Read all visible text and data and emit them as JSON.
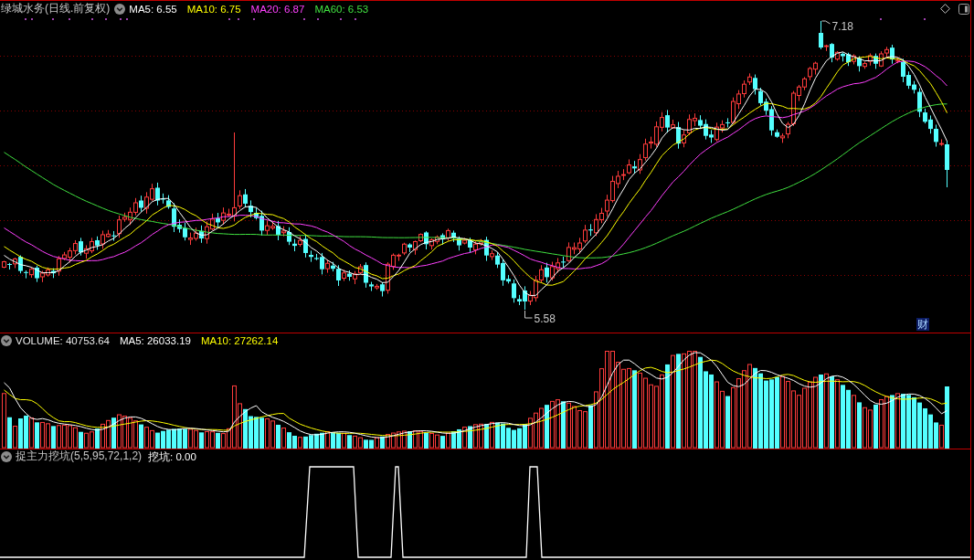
{
  "price_panel": {
    "title": "绿城水务(日线.前复权)",
    "indicators": [
      {
        "label": "MA5: 6.55",
        "color": "#ffffff"
      },
      {
        "label": "MA10: 6.75",
        "color": "#ffff00"
      },
      {
        "label": "MA20: 6.87",
        "color": "#ff40ff"
      },
      {
        "label": "MA60: 6.53",
        "color": "#40e040"
      }
    ],
    "high_label": "7.18",
    "low_label": "5.58",
    "badge": "财"
  },
  "volume_panel": {
    "indicators": [
      {
        "label": "VOLUME: 40753.64",
        "color": "#e8e8e8"
      },
      {
        "label": "MA5: 26033.19",
        "color": "#ffffff"
      },
      {
        "label": "MA10: 27262.14",
        "color": "#ffff00"
      }
    ]
  },
  "indicator_panel": {
    "title": "捉主力挖坑(5,5,95,72,1,2)",
    "indicators": [
      {
        "label": "挖坑: 0.00",
        "color": "#ffffff"
      }
    ]
  }
}
